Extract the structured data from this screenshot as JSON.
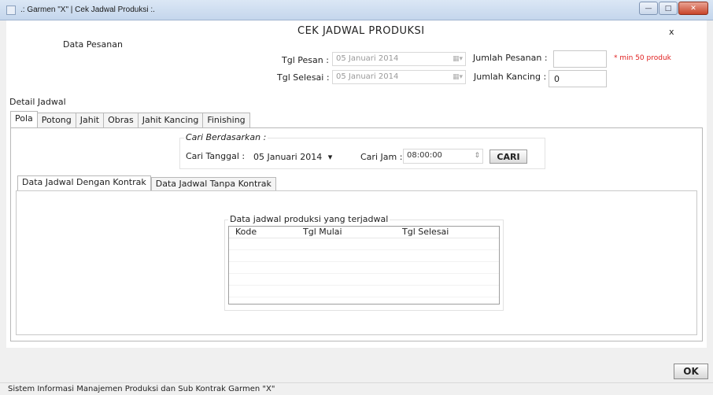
{
  "window": {
    "title": ".: Garmen \"X\" | Cek Jadwal Produksi :.",
    "min_label": "—",
    "max_label": "□",
    "close_label": "✕"
  },
  "form": {
    "title": "CEK JADWAL PRODUKSI",
    "close_x": "x",
    "section_label": "Data Pesanan"
  },
  "pesanan": {
    "tgl_pesan_label": "Tgl Pesan :",
    "tgl_pesan_value": "05   Januari   2014",
    "tgl_selesai_label": "Tgl Selesai :",
    "tgl_selesai_value": "05   Januari   2014",
    "jumlah_pesanan_label": "Jumlah Pesanan :",
    "jumlah_pesanan_value": "",
    "jumlah_pesanan_note": "* min 50 produk",
    "jumlah_kancing_label": "Jumlah Kancing :",
    "jumlah_kancing_value": "0"
  },
  "detail": {
    "label": "Detail Jadwal",
    "tabs": [
      "Pola",
      "Potong",
      "Jahit",
      "Obras",
      "Jahit Kancing",
      "Finishing"
    ],
    "active_tab": "Pola"
  },
  "search": {
    "group_label": "Cari Berdasarkan :",
    "tanggal_label": "Cari Tanggal :",
    "tanggal_value": "05   Januari   2014",
    "jam_label": "Cari Jam :",
    "jam_value": "08:00:00",
    "button_label": "CARI"
  },
  "subtabs": {
    "items": [
      "Data Jadwal Dengan Kontrak",
      "Data Jadwal Tanpa Kontrak"
    ],
    "active": "Data Jadwal Dengan Kontrak"
  },
  "table": {
    "group_label": "Data jadwal produksi yang terjadwal",
    "columns": [
      "Kode",
      "Tgl Mulai",
      "Tgl Selesai"
    ]
  },
  "footer": {
    "ok_label": "OK",
    "status_text": "Sistem Informasi Manajemen Produksi dan Sub Kontrak Garmen \"X\""
  }
}
